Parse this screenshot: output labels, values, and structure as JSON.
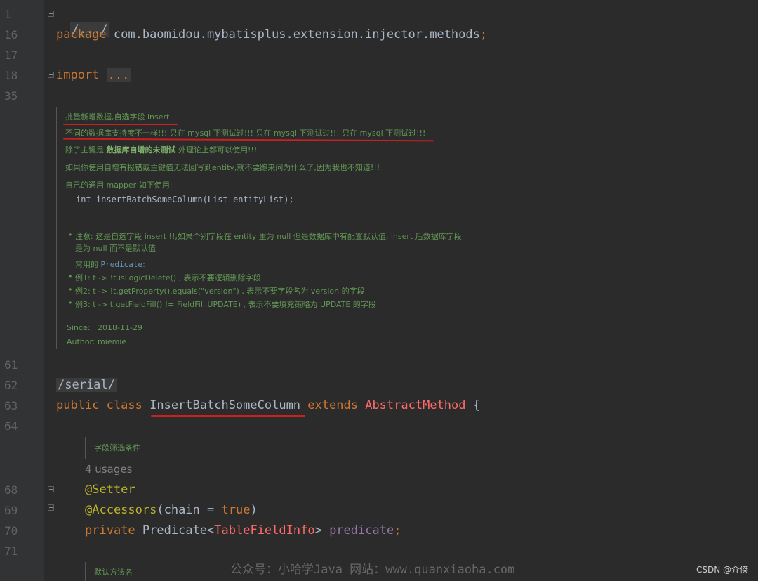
{
  "gutter": {
    "line_numbers": [
      "1",
      "16",
      "17",
      "18",
      "35",
      "61",
      "62",
      "63",
      "64",
      "68",
      "69",
      "70",
      "71"
    ]
  },
  "code": {
    "line1_folded": "/.../",
    "package_kw": "package",
    "package_name": " com.baomidou.mybatisplus.extension.injector.methods",
    "semicolon": ";",
    "import_kw": "import",
    "import_ellipsis": "...",
    "serial_folded": "/serial/",
    "public_kw": "public",
    "class_kw": "class",
    "class_name": "InsertBatchSomeColumn",
    "extends_kw": "extends",
    "super_class": "AbstractMethod",
    "brace": "{",
    "setter_ann": "@Setter",
    "accessors_ann": "@Accessors",
    "accessors_args_open": "(chain = ",
    "true_kw": "true",
    "accessors_args_close": ")",
    "private_kw": "private",
    "predicate_type": "Predicate",
    "lt": "<",
    "generic_type": "TableFieldInfo",
    "gt": "> ",
    "field_name": "predicate",
    "usages": "4 usages"
  },
  "doc": {
    "line1": "批量新增数据,自选字段 insert",
    "line2": "不同的数据库支持度不一样!!! 只在 mysql 下测试过!!! 只在 mysql 下测试过!!! 只在 mysql 下测试过!!!",
    "line3_a": "除了主键是 ",
    "line3_b": "数据库自增的未测试",
    "line3_c": " 外理论上都可以使用!!!",
    "line4": "如果你使用自增有报错或主键值无法回写到entity,就不要跑来问为什么了,因为我也不知道!!!",
    "line5": "自己的通用 mapper 如下使用:",
    "code_sample": "int insertBatchSomeColumn(List entityList);",
    "note1": "注意: 这是自选字段 insert !!,如果个别字段在 entity 里为 null 但是数据库中有配置默认值, insert 后数据库字段",
    "note1b": "是为 null 而不是默认值",
    "common_a": "常用的 ",
    "common_b": "Predicate",
    "common_c": ":",
    "ex1": "例1: t -> !t.isLogicDelete() , 表示不要逻辑删除字段",
    "ex2": "例2: t -> !t.getProperty().equals(\"version\") , 表示不要字段名为 version 的字段",
    "ex3": "例3: t -> t.getFieldFill() != FieldFill.UPDATE) , 表示不要填充策略为 UPDATE 的字段",
    "since_label": "Since:",
    "since_value": "2018-11-29",
    "author_label": "Author:",
    "author_value": "miemie",
    "field_doc": "字段筛选条件",
    "method_doc": "默认方法名"
  },
  "overlay": {
    "watermark": "公众号：小哈学Java 网站：www.quanxiaoha.com",
    "csdn": "CSDN @介傑"
  }
}
